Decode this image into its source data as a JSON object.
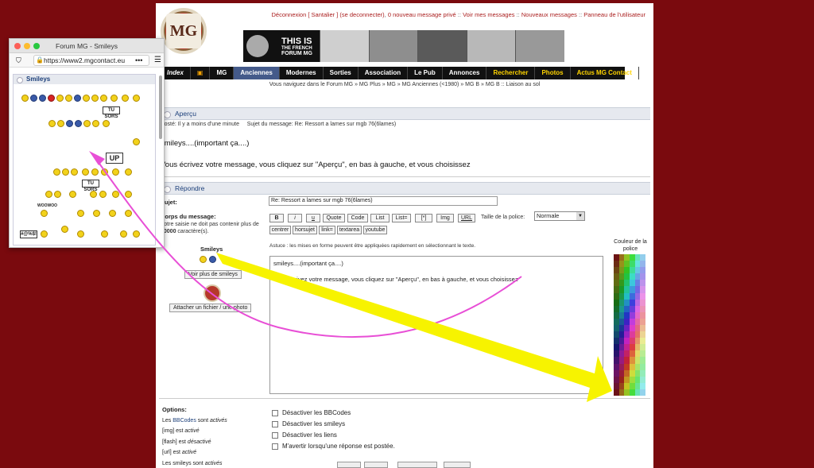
{
  "header": {
    "toplinks": [
      "Déconnexion [ Santalier ] (se deconnecter)",
      "0 nouveau message privé",
      "Voir mes messages",
      "Nouveaux messages",
      "Panneau de l'utilisateur"
    ],
    "banner_line1": "THIS IS",
    "banner_line2": "THE FRENCH",
    "banner_line3": "FORUM MG",
    "logo_text": "MG"
  },
  "nav": {
    "items": [
      "Index",
      "MG",
      "Anciennes",
      "Modernes",
      "Sorties",
      "Association",
      "Le Pub",
      "Annonces",
      "Rechercher",
      "Photos",
      "Actus MG Contact"
    ]
  },
  "breadcrumb": "Vous naviguez dans le Forum MG » MG Plus » MG » MG Anciennes (<1980) » MG B » MG B :: Liaison au sol",
  "preview": {
    "title": "Aperçu",
    "meta_posted": "Posté: Il y a moins d'une minute",
    "meta_subject": "Sujet du message: Re: Ressort a lames sur mgb 76(6lames)",
    "line1": "smileys....(important ça....)",
    "line2": "Vous écrivez votre message, vous cliquez sur \"Aperçu\", en bas à gauche, et vous choisissez"
  },
  "reply": {
    "title": "Répondre",
    "subject_label": "Sujet:",
    "subject_value": "Re: Ressort a lames sur mgb 76(6lames)",
    "body_label": "Corps du message:",
    "body_hint": "Votre saisie ne doit pas contenir plus de",
    "body_limit": "60000",
    "body_hint_end": "caractère(s).",
    "smileys_label": "Smileys",
    "more_smileys": "Voir plus de smileys",
    "attach": "Attacher un fichier / une photo",
    "toolbar": [
      "B",
      "i",
      "u",
      "Quote",
      "Code",
      "List",
      "List=",
      "[*]",
      "Img",
      "URL"
    ],
    "toolbar2": [
      "centrer",
      "horsujet",
      "link=",
      "textarea",
      "youtube"
    ],
    "font_size_label": "Taille de la police:",
    "font_size_value": "Normale",
    "tip": "Astuce : les mises en forme peuvent être appliquées rapidement en sélectionnant le texte.",
    "color_label": "Couleur de la police",
    "text_line1": "smileys....(important ça....)",
    "text_line2": "Vous écrivez votre message, vous cliquez sur \"Aperçu\", en bas à gauche, et vous choisissez"
  },
  "options": {
    "title": "Options:",
    "l1a": "Les",
    "l1b": "BBCodes",
    "l1c": "sont",
    "l1d": "activés",
    "l2a": "[img] est",
    "l2b": "activé",
    "l3a": "[flash] est",
    "l3b": "désactivé",
    "l4a": "[url] est",
    "l4b": "activé",
    "l5a": "Les smileys sont",
    "l5b": "activés",
    "checks": [
      "Désactiver les BBCodes",
      "Désactiver les smileys",
      "Désactiver les liens",
      "M'avertir lorsqu'une réponse est postée."
    ]
  },
  "popup": {
    "title": "Forum MG - Smileys",
    "url": "https://www2.mgcontact.eu",
    "head": "Smileys",
    "sign1": "TU SORS",
    "sign2": "UP",
    "sign3": "TU SORS",
    "sign4": "#@%$!",
    "wooo": "WOOWOO"
  },
  "colors": {
    "accent_red": "#7a0a0e",
    "nav_active": "#445a8a",
    "nav_yellow": "#ffd400",
    "arrow_yellow": "#f7f300",
    "arrow_pink": "#e84fd6"
  }
}
